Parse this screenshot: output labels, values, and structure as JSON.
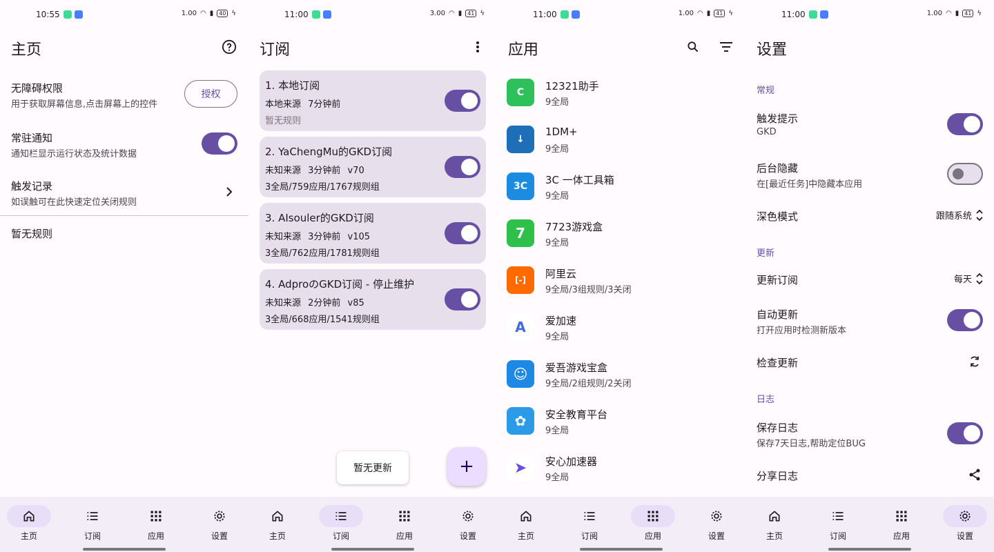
{
  "status": [
    {
      "time": "10:55",
      "speed": "1.00",
      "battery": "40"
    },
    {
      "time": "11:00",
      "speed": "3.00",
      "battery": "41"
    },
    {
      "time": "11:00",
      "speed": "1.00",
      "battery": "41"
    },
    {
      "time": "11:00",
      "speed": "1.00",
      "battery": "41"
    }
  ],
  "nav": {
    "home": "主页",
    "subs": "订阅",
    "apps": "应用",
    "settings": "设置"
  },
  "home": {
    "title": "主页",
    "accessibility": {
      "title": "无障碍权限",
      "desc": "用于获取屏幕信息,点击屏幕上的控件",
      "button": "授权"
    },
    "notification": {
      "title": "常驻通知",
      "desc": "通知栏显示运行状态及统计数据",
      "enabled": true
    },
    "trigger_log": {
      "title": "触发记录",
      "desc": "如误触可在此快速定位关闭规则"
    },
    "empty": "暂无规则"
  },
  "subscriptions": {
    "title": "订阅",
    "items": [
      {
        "name": "1. 本地订阅",
        "meta": "本地来源 7分钟前",
        "detail": "暂无规则",
        "enabled": true
      },
      {
        "name": "2. YaChengMu的GKD订阅",
        "meta": "未知来源 3分钟前 v70",
        "detail": "3全局/759应用/1767规则组",
        "enabled": true
      },
      {
        "name": "3. AIsouler的GKD订阅",
        "meta": "未知来源 3分钟前 v105",
        "detail": "3全局/762应用/1781规则组",
        "enabled": true
      },
      {
        "name": "4. AdproのGKD订阅 - 停止维护",
        "meta": "未知来源 2分钟前 v85",
        "detail": "3全局/668应用/1541规则组",
        "enabled": true
      }
    ],
    "snackbar": "暂无更新",
    "fab_icon": "+"
  },
  "apps": {
    "title": "应用",
    "items": [
      {
        "name": "12321助手",
        "sub": "9全局",
        "color": "#2ec05a",
        "glyph": "C"
      },
      {
        "name": "1DM+",
        "sub": "9全局",
        "color": "#1e6fb8",
        "glyph": "↓"
      },
      {
        "name": "3C 一体工具箱",
        "sub": "9全局",
        "color": "#1c8be0",
        "glyph": "3C"
      },
      {
        "name": "7723游戏盒",
        "sub": "9全局",
        "color": "#2ec04a",
        "glyph": "7"
      },
      {
        "name": "阿里云",
        "sub": "9全局/3组规则/3关闭",
        "color": "#ff6a00",
        "glyph": "[-]"
      },
      {
        "name": "爱加速",
        "sub": "9全局",
        "color": "#ffffff",
        "glyph": "A"
      },
      {
        "name": "爱吾游戏宝盒",
        "sub": "9全局/2组规则/2关闭",
        "color": "#1e88e5",
        "glyph": "☺"
      },
      {
        "name": "安全教育平台",
        "sub": "9全局",
        "color": "#2b9be8",
        "glyph": "✿"
      },
      {
        "name": "安心加速器",
        "sub": "9全局",
        "color": "#ffffff",
        "glyph": "➤"
      }
    ]
  },
  "settings": {
    "title": "设置",
    "sections": {
      "general": "常规",
      "update": "更新",
      "log": "日志"
    },
    "trigger_tip": {
      "title": "触发提示",
      "desc": "GKD",
      "enabled": true
    },
    "hide_recent": {
      "title": "后台隐藏",
      "desc": "在[最近任务]中隐藏本应用",
      "enabled": false
    },
    "dark_mode": {
      "title": "深色模式",
      "value": "跟随系统"
    },
    "update_subs": {
      "title": "更新订阅",
      "value": "每天"
    },
    "auto_update": {
      "title": "自动更新",
      "desc": "打开应用时检测新版本",
      "enabled": true
    },
    "check_update": {
      "title": "检查更新"
    },
    "save_log": {
      "title": "保存日志",
      "desc": "保存7天日志,帮助定位BUG",
      "enabled": true
    },
    "share_log": {
      "title": "分享日志"
    }
  },
  "colors": {
    "primary": "#6750a4",
    "card": "#e7e0ec",
    "nav_bg": "#f3edf7",
    "active_pill": "#e8def8"
  }
}
